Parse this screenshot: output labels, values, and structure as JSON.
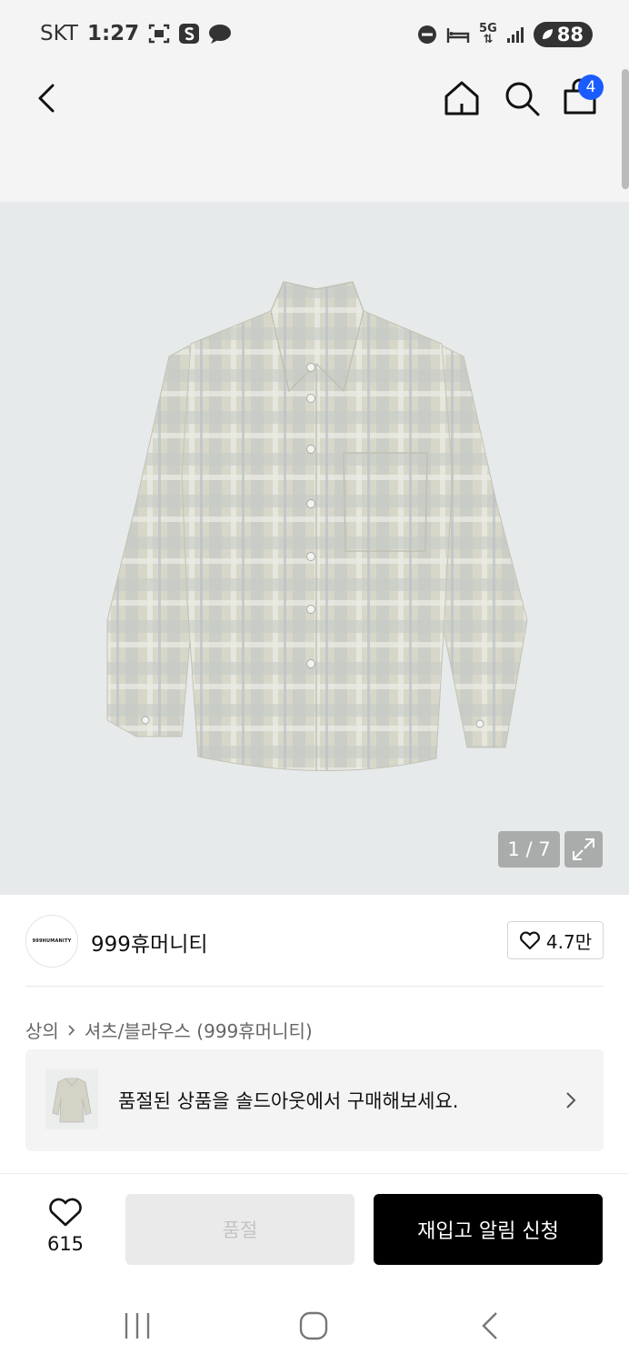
{
  "status_bar": {
    "carrier": "SKT",
    "time": "1:27",
    "network": "5G",
    "battery": "88"
  },
  "header": {
    "cart_count": "4"
  },
  "gallery": {
    "counter": "1 / 7"
  },
  "brand": {
    "logo_text": "999HUMANITY",
    "name": "999휴머니티",
    "likes": "4.7만"
  },
  "breadcrumb": {
    "category": "상의",
    "subcategory": "셔츠/블라우스 (999휴머니티)"
  },
  "soldout_banner": {
    "text": "품절된 상품을 솔드아웃에서 구매해보세요."
  },
  "actions": {
    "wish_count": "615",
    "soldout_label": "품절",
    "restock_label": "재입고 알림 신청"
  },
  "colors": {
    "accent": "#1b5cff",
    "primary_button": "#000000",
    "disabled_button": "#eaeaea"
  }
}
